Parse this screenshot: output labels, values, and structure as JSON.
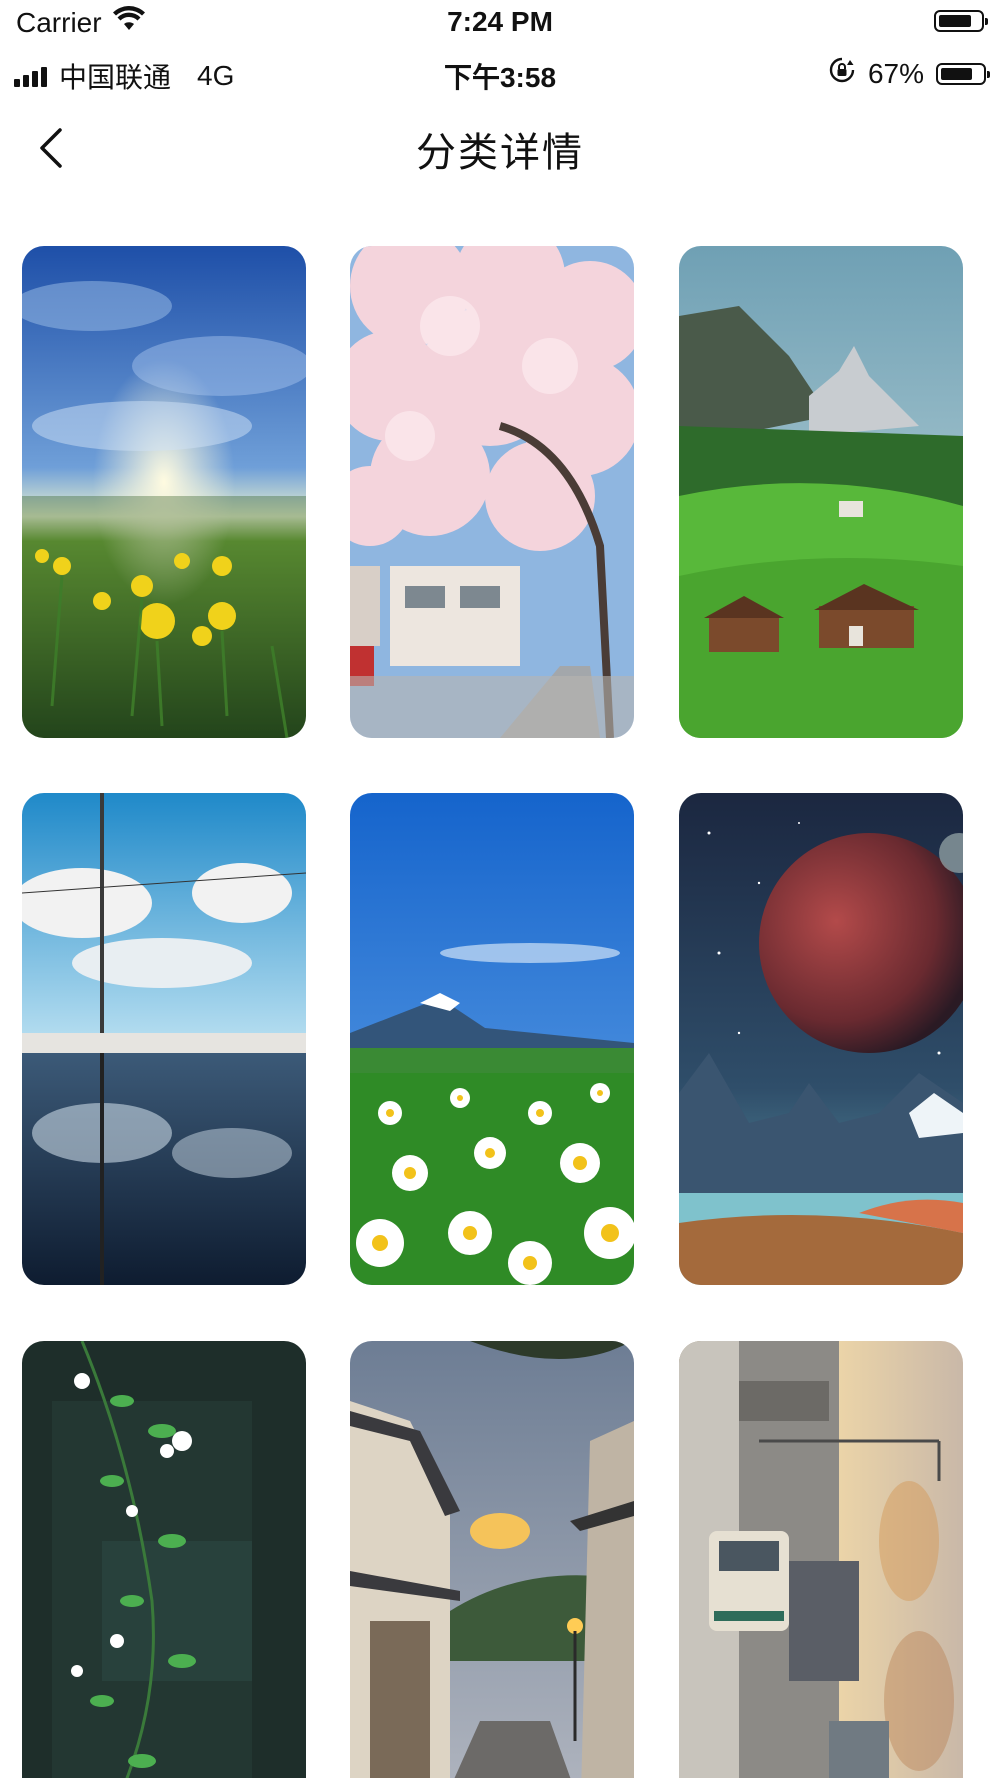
{
  "status_bar": {
    "carrier": "Carrier",
    "time": "7:24 PM"
  },
  "system_bar": {
    "carrier": "中国联通",
    "network": "4G",
    "time": "下午3:58",
    "battery_percent": "67%",
    "battery_level": 0.67
  },
  "nav": {
    "title": "分类详情"
  },
  "wallpapers": [
    {
      "name": "daffodil-field-sunrise"
    },
    {
      "name": "cherry-blossom-street"
    },
    {
      "name": "alpine-meadow-houses"
    },
    {
      "name": "puddle-reflection-sky"
    },
    {
      "name": "mount-fuji-daisies"
    },
    {
      "name": "red-planet-mountains"
    },
    {
      "name": "white-flower-vine"
    },
    {
      "name": "japanese-alley-evening"
    },
    {
      "name": "city-street-sunset"
    }
  ]
}
